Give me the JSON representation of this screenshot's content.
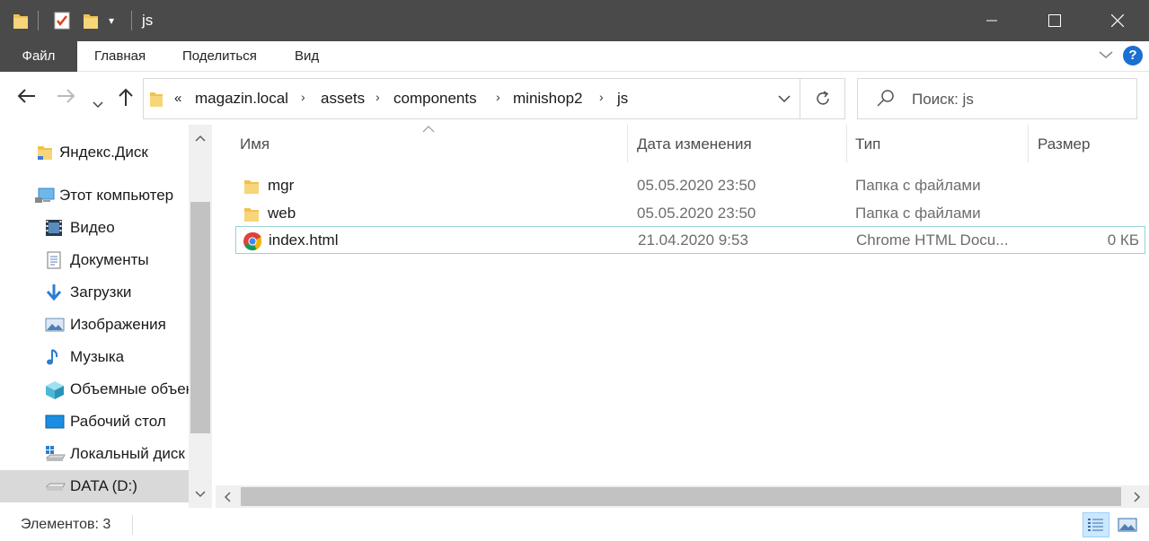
{
  "window": {
    "title": "js",
    "minimize": "—",
    "maximize": "☐",
    "close": "✕"
  },
  "ribbon": {
    "tabs": [
      "Файл",
      "Главная",
      "Поделиться",
      "Вид"
    ],
    "help": "?"
  },
  "nav": {
    "back": "←",
    "forward": "→",
    "recent": "⌄",
    "up": "↑",
    "overflow": "«",
    "path": [
      "magazin.local",
      "assets",
      "components",
      "minishop2",
      "js"
    ],
    "refresh": "↻"
  },
  "search": {
    "placeholder": "Поиск: js"
  },
  "sidebar": {
    "items": [
      {
        "label": "Яндекс.Диск",
        "icon": "folder-icon"
      },
      {
        "label": "Этот компьютер",
        "icon": "computer-icon"
      },
      {
        "label": "Видео",
        "icon": "video-icon"
      },
      {
        "label": "Документы",
        "icon": "documents-icon"
      },
      {
        "label": "Загрузки",
        "icon": "download-icon"
      },
      {
        "label": "Изображения",
        "icon": "pictures-icon"
      },
      {
        "label": "Музыка",
        "icon": "music-icon"
      },
      {
        "label": "Объемные объекты",
        "icon": "3d-objects-icon"
      },
      {
        "label": "Рабочий стол",
        "icon": "desktop-icon"
      },
      {
        "label": "Локальный диск (C:)",
        "icon": "drive-icon"
      },
      {
        "label": "DATA (D:)",
        "icon": "drive-icon"
      }
    ]
  },
  "columns": {
    "name": "Имя",
    "date": "Дата изменения",
    "type": "Тип",
    "size": "Размер"
  },
  "files": [
    {
      "name": "mgr",
      "date": "05.05.2020 23:50",
      "type": "Папка с файлами",
      "size": "",
      "icon": "folder-icon"
    },
    {
      "name": "web",
      "date": "05.05.2020 23:50",
      "type": "Папка с файлами",
      "size": "",
      "icon": "folder-icon"
    },
    {
      "name": "index.html",
      "date": "21.04.2020 9:53",
      "type": "Chrome HTML Docu...",
      "size": "0 КБ",
      "icon": "chrome-icon"
    }
  ],
  "status": {
    "count": "Элементов: 3"
  },
  "colors": {
    "titlebar": "#4a4a4a",
    "accent": "#1a6fd1",
    "selected": "#d9d9d9",
    "focus_border": "#99d1d9"
  }
}
